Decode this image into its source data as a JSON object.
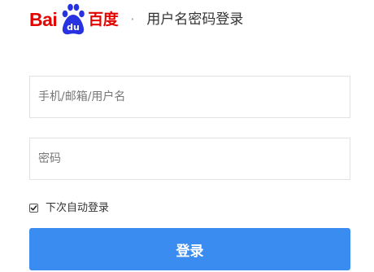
{
  "brand": {
    "logo_latin": "Bai",
    "logo_cjk": "百度",
    "paw_text": "du",
    "color": "#e10602"
  },
  "header": {
    "separator": "·",
    "title": "用户名密码登录"
  },
  "form": {
    "username": {
      "placeholder": "手机/邮箱/用户名",
      "value": ""
    },
    "password": {
      "placeholder": "密码",
      "value": ""
    },
    "remember": {
      "label": "下次自动登录",
      "checked": true
    },
    "submit_label": "登录",
    "submit_color": "#3b8cf0"
  }
}
